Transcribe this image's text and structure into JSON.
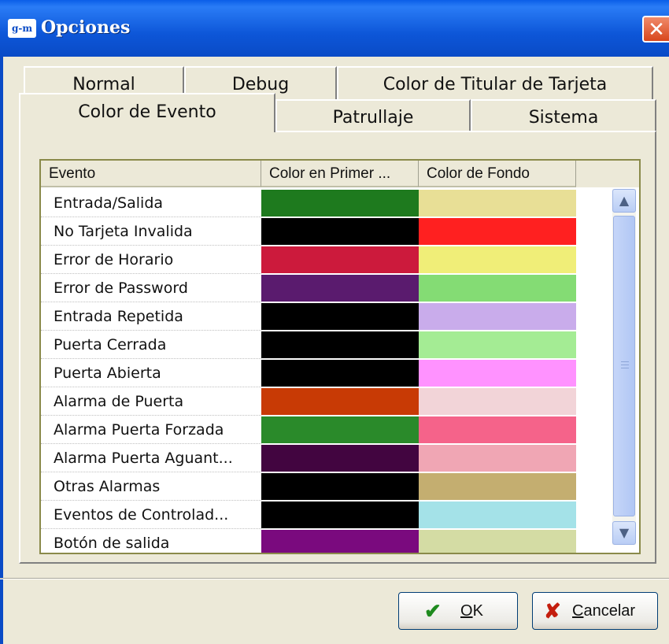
{
  "window": {
    "title": "Opciones",
    "app_icon_text": "g-m",
    "close_glyph": "✕"
  },
  "tabs_row1": [
    "Normal",
    "Debug",
    "Color de Titular de Tarjeta"
  ],
  "tabs_row2": [
    "Color de Evento",
    "Patrullaje",
    "Sistema"
  ],
  "active_tab": "Color de Evento",
  "list": {
    "columns": [
      "Evento",
      "Color en Primer ...",
      "Color de Fondo"
    ],
    "rows": [
      {
        "name": "Entrada/Salida",
        "fg": "#1e7a1e",
        "bg": "#e8df96"
      },
      {
        "name": "No Tarjeta Invalida",
        "fg": "#000000",
        "bg": "#ff2020"
      },
      {
        "name": "Error de Horario",
        "fg": "#cc1a3c",
        "bg": "#f0ee78"
      },
      {
        "name": "Error de Password",
        "fg": "#5a1b6e",
        "bg": "#84dc74"
      },
      {
        "name": "Entrada Repetida",
        "fg": "#000000",
        "bg": "#c9aceb"
      },
      {
        "name": "Puerta Cerrada",
        "fg": "#000000",
        "bg": "#a4ec94"
      },
      {
        "name": "Puerta Abierta",
        "fg": "#000000",
        "bg": "#ff92ff"
      },
      {
        "name": "Alarma de Puerta",
        "fg": "#c83a05",
        "bg": "#f2d4d8"
      },
      {
        "name": "Alarma Puerta Forzada",
        "fg": "#2a8a2a",
        "bg": "#f5638a"
      },
      {
        "name": "Alarma Puerta Aguant...",
        "fg": "#420540",
        "bg": "#f0a6b4"
      },
      {
        "name": "Otras Alarmas",
        "fg": "#000000",
        "bg": "#c4ae70"
      },
      {
        "name": "Eventos de Controlad...",
        "fg": "#000000",
        "bg": "#a4e2e8"
      },
      {
        "name": "Botón de salida",
        "fg": "#7a0a7e",
        "bg": "#d4dca4"
      }
    ],
    "scroll_up_icon": "chevron-up-icon",
    "scroll_down_icon": "chevron-down-icon"
  },
  "buttons": {
    "ok_label": "OK",
    "ok_icon": "checkmark-icon",
    "cancel_label": "Cancelar",
    "cancel_icon": "x-icon"
  },
  "colors": {
    "titlebar": "#0a4bc6",
    "face": "#ece9d8",
    "close": "#d8461c"
  }
}
